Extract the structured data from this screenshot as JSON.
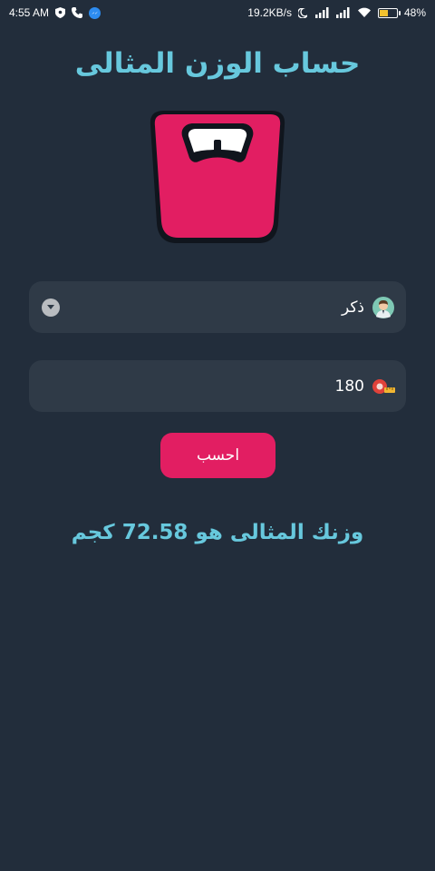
{
  "status_bar": {
    "time": "4:55 AM",
    "net_speed": "19.2KB/s",
    "battery_percent": "48%",
    "battery_level": 0.48,
    "icons": [
      "shield-icon",
      "phone-icon",
      "messenger-icon",
      "moon-icon",
      "signal-icon",
      "wifi-icon",
      "battery-icon"
    ]
  },
  "app": {
    "title": "حساب الوزن المثالى",
    "logo_icon": "weighing-scale-icon",
    "accent_color": "#e21e62",
    "text_accent": "#67c8dd"
  },
  "form": {
    "gender": {
      "selected": "ذكر",
      "icon": "man-avatar-icon"
    },
    "height": {
      "value": "180",
      "icon": "tape-measure-icon"
    },
    "calculate_label": "احسب"
  },
  "result": {
    "text": "وزنك المثالى هو 72.58 كجم"
  }
}
